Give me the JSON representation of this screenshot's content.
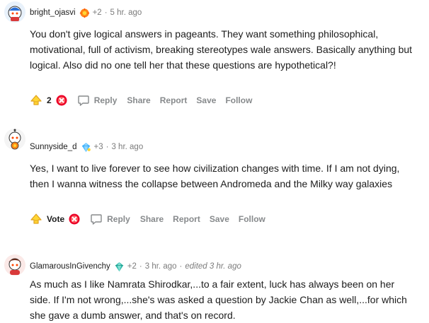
{
  "comments": [
    {
      "username": "bright_ojasvi",
      "karma": "+2",
      "separator": "·",
      "time": "5 hr. ago",
      "body": "You don't give logical answers in pageants. They want something philosophical, motivational, full of activism, breaking stereotypes wale answers. Basically anything but logical. Also did no one tell her that these questions are hypothetical?!",
      "score": "2",
      "reply": "Reply",
      "share": "Share",
      "report": "Report",
      "save": "Save",
      "follow": "Follow"
    },
    {
      "username": "Sunnyside_d",
      "karma": "+3",
      "separator": "·",
      "time": "3 hr. ago",
      "body": "Yes, I want to live forever to see how civilization changes with time. If I am not dying, then I wanna witness the collapse between Andromeda and the Milky way galaxies",
      "score": "Vote",
      "reply": "Reply",
      "share": "Share",
      "report": "Report",
      "save": "Save",
      "follow": "Follow"
    },
    {
      "username": "GlamarousInGivenchy",
      "karma": "+2",
      "separator": "·",
      "time": "3 hr. ago",
      "separator2": "·",
      "edited": "edited 3 hr. ago",
      "body": "As much as I like Namrata Shirodkar,...to a fair extent, luck has always been on her side. If I'm not wrong,...she's was asked a question by Jackie Chan as well,...for which she gave a dumb answer, and that's on record."
    }
  ],
  "colors": {
    "upvote": "#f2b23a",
    "downvote": "#ea0027",
    "meta": "#7c7c7c",
    "action": "#878a8c"
  },
  "icons": {
    "upvote": "upvote-arrow-icon",
    "downvote": "downvote-x-icon",
    "reply": "speech-bubble-icon",
    "flair_1": "orange-gear-flair-icon",
    "flair_2": "crystal-flair-icon",
    "flair_3": "crystal-flair-icon"
  }
}
